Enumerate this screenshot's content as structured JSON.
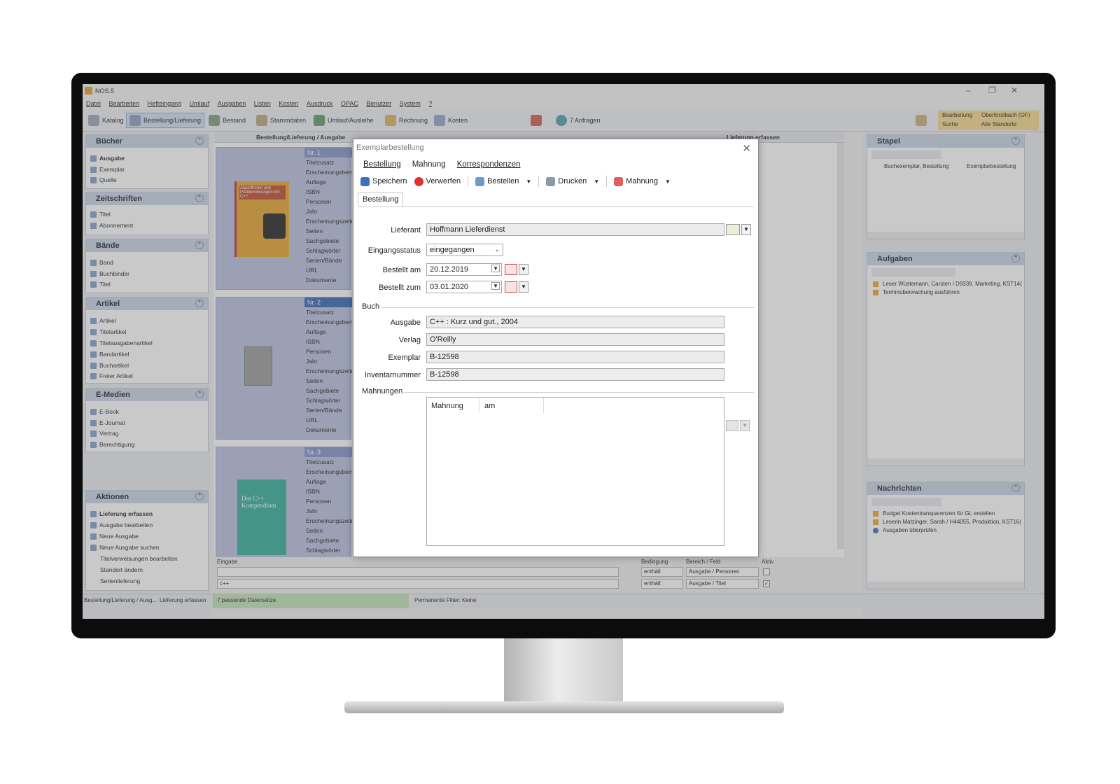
{
  "app": {
    "title": "NOS.5",
    "menu": [
      "Datei",
      "Bearbeiten",
      "Hefteingang",
      "Umlauf",
      "Ausgaben",
      "Listen",
      "Kosten",
      "Ausdruck",
      "OPAC",
      "Benutzer",
      "System",
      "?"
    ],
    "toolbar": [
      "Katalog",
      "Bestellung/Lieferung",
      "Bestand",
      "Stammdaten",
      "Umlauf/Ausleihe",
      "Rechnung",
      "Kosten",
      "7 Anfragen"
    ],
    "location": {
      "mode1": "Bearbeitung",
      "mode2": "Suche",
      "place1": "Oberforstbach (OF)",
      "place2": "Alle Standorte"
    }
  },
  "left": {
    "groups": [
      {
        "title": "Bücher",
        "items": [
          "Ausgabe",
          "Exemplar",
          "Quelle"
        ]
      },
      {
        "title": "Zeitschriften",
        "items": [
          "Titel",
          "Abonnement"
        ]
      },
      {
        "title": "Bände",
        "items": [
          "Band",
          "Buchbinder",
          "Titel"
        ]
      },
      {
        "title": "Artikel",
        "items": [
          "Artikel",
          "Titelartikel",
          "Titelausgabenartikel",
          "Bandartikel",
          "Buchartikel",
          "Freier Artikel"
        ]
      },
      {
        "title": "E-Medien",
        "items": [
          "E-Book",
          "E-Journal",
          "Vertrag",
          "Berechtigung"
        ]
      }
    ],
    "actions": {
      "title": "Aktionen",
      "items": [
        "Lieferung erfassen",
        "Ausgabe bearbeiten",
        "Neue Ausgabe",
        "Neue Ausgabe suchen",
        "Titelverweisungen bearbeiten",
        "Standort ändern",
        "Serienlieferung"
      ]
    }
  },
  "list": {
    "breadcrumb": "Bestellung/Lieferung / Ausgabe",
    "side_title": "Lieferung erfassen",
    "fields": [
      "Titelzusatz",
      "Erscheinungsbemerkung",
      "Auflage",
      "ISBN",
      "Personen",
      "Jahr",
      "Erscheinungszeitraum",
      "Seiten",
      "Sachgebiete",
      "Schlagwörter",
      "Serien/Bände",
      "URL",
      "Dokumente"
    ],
    "records": [
      {
        "nr": "Nr. 1",
        "cover_title": "Algorithmen und Problemlösungen mit C++"
      },
      {
        "nr": "Nr. 2",
        "cover_title": ""
      },
      {
        "nr": "Nr. 3",
        "cover_title": "Das C++ Kompendium"
      }
    ]
  },
  "right": {
    "stapel": {
      "title": "Stapel",
      "rows": [
        {
          "a": "Buchexemplar, Bestellung",
          "b": "Exemplarbestellung"
        }
      ]
    },
    "aufgaben": {
      "title": "Aufgaben",
      "items": [
        "Leser Wüstemann, Carsten / D9339, Marketing, KST14(",
        "Terminüberwachung ausführen"
      ]
    },
    "nachrichten": {
      "title": "Nachrichten",
      "items": [
        "Budget Kostentransparenzen für GL erstellen",
        "Leserin Matzinger, Sarah / H44055, Produktion, KST16(",
        "Ausgaben überprüfen"
      ]
    }
  },
  "bottom": {
    "eingabe_label": "Eingabe",
    "eingabe_value": "c++",
    "bedingung_label": "Bedingung",
    "bereich_label": "Bereich / Feld",
    "aktiv_label": "Aktiv",
    "rows": [
      {
        "bedingung": "enthält",
        "bereich": "Ausgabe / Personen"
      },
      {
        "bedingung": "enthält",
        "bereich": "Ausgabe / Titel"
      }
    ]
  },
  "status": {
    "s1": "Bestellung/Lieferung / Ausg...",
    "s2": "Lieferung erfassen",
    "s3": "7 passende Datensätze.",
    "s4": "Permanente Filter: Keine"
  },
  "dialog": {
    "title": "Exemplarbestellung",
    "menu": [
      "Bestellung",
      "Mahnung",
      "Korrespondenzen"
    ],
    "toolbar": {
      "save": "Speichern",
      "discard": "Verwerfen",
      "order": "Bestellen",
      "print": "Drucken",
      "reminder": "Mahnung"
    },
    "tab": "Bestellung",
    "fields": {
      "lieferant": {
        "label": "Lieferant",
        "value": "Hoffmann Lieferdienst"
      },
      "eingangsstatus": {
        "label": "Eingangsstatus",
        "value": "eingegangen"
      },
      "bestellt_am": {
        "label": "Bestellt am",
        "value": "20.12.2019"
      },
      "bestellt_zum": {
        "label": "Bestellt zum",
        "value": "03.01.2020"
      }
    },
    "buch": {
      "section": "Buch",
      "ausgabe": {
        "label": "Ausgabe",
        "value": "C++ : Kurz und gut., 2004"
      },
      "verlag": {
        "label": "Verlag",
        "value": "O'Reilly"
      },
      "exemplar": {
        "label": "Exemplar",
        "value": "B-12598"
      },
      "inventarnummer": {
        "label": "Inventarnummer",
        "value": "B-12598"
      }
    },
    "mahnungen": {
      "section": "Mahnungen",
      "columns": [
        "Mahnung",
        "am"
      ]
    }
  }
}
